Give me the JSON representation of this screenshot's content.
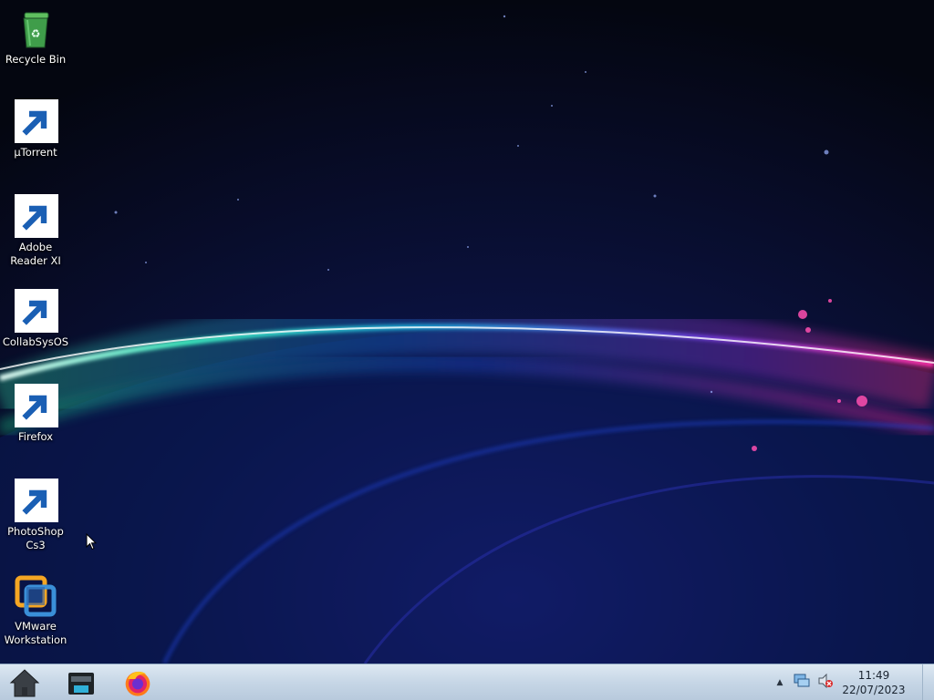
{
  "desktop": {
    "icons": [
      {
        "label": "Recycle Bin",
        "icon": "recycle-bin-icon"
      },
      {
        "label": "µTorrent",
        "icon": "utorrent-icon"
      },
      {
        "label": "Adobe Reader XI",
        "icon": "adobe-reader-icon"
      },
      {
        "label": "CollabSysOS",
        "icon": "folder-icon"
      },
      {
        "label": "Firefox",
        "icon": "firefox-icon"
      },
      {
        "label": "PhotoShop Cs3",
        "icon": "photoshop-icon"
      },
      {
        "label": "VMware Workstation",
        "icon": "vmware-icon"
      }
    ]
  },
  "taskbar": {
    "pinned": [
      "home-icon",
      "file-manager-icon",
      "firefox-icon"
    ],
    "tray": {
      "icons": [
        "show-hidden-icons-arrow",
        "network-icon",
        "volume-muted-icon"
      ],
      "time": "11:49",
      "date": "22/07/2023"
    }
  },
  "colors": {
    "taskbar_top": "#dde8f2",
    "taskbar_bottom": "#b7c9dc",
    "wallpaper_base": "#050814"
  }
}
